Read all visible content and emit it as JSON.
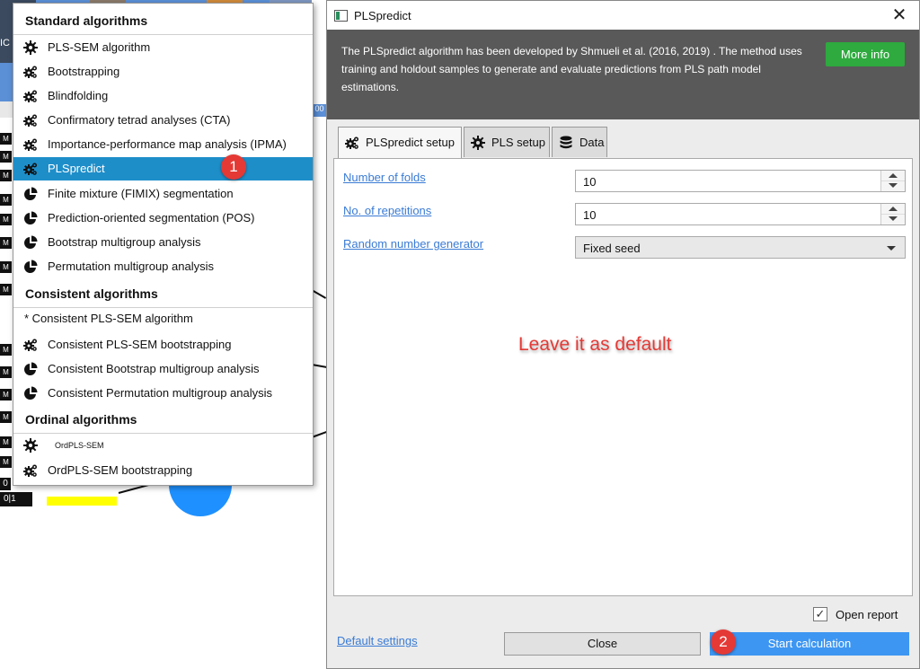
{
  "background": {
    "mini_labels": [
      "M",
      "M",
      "M",
      "M",
      "M",
      "M",
      "M",
      "M",
      "M",
      "M",
      "M",
      "M",
      "M",
      "M"
    ],
    "edge_label_1": "IC",
    "edge_label_2": "00",
    "zero": "0",
    "zero_one": "0|1"
  },
  "menu": {
    "sections": {
      "standard": "Standard algorithms",
      "consistent": "Consistent algorithms",
      "ordinal": "Ordinal algorithms"
    },
    "items": [
      {
        "label": "PLS-SEM algorithm",
        "icon": "gear-icon"
      },
      {
        "label": "Bootstrapping",
        "icon": "gears-icon"
      },
      {
        "label": "Blindfolding",
        "icon": "gears-icon"
      },
      {
        "label": "Confirmatory tetrad analyses (CTA)",
        "icon": "gears-icon"
      },
      {
        "label": "Importance-performance map analysis (IPMA)",
        "icon": "gears-icon"
      },
      {
        "label": "PLSpredict",
        "icon": "gears-icon"
      },
      {
        "label": "Finite mixture (FIMIX) segmentation",
        "icon": "pie-chart-icon"
      },
      {
        "label": "Prediction-oriented segmentation (POS)",
        "icon": "pie-chart-icon"
      },
      {
        "label": "Bootstrap multigroup analysis",
        "icon": "pie-chart-icon"
      },
      {
        "label": "Permutation multigroup analysis",
        "icon": "pie-chart-icon"
      },
      {
        "label": "* Consistent PLS-SEM algorithm",
        "icon": ""
      },
      {
        "label": "Consistent PLS-SEM bootstrapping",
        "icon": "gears-icon"
      },
      {
        "label": "Consistent Bootstrap multigroup analysis",
        "icon": "pie-chart-icon"
      },
      {
        "label": "Consistent Permutation multigroup analysis",
        "icon": "pie-chart-icon"
      },
      {
        "label": "OrdPLS-SEM",
        "icon": "gear-icon"
      },
      {
        "label": "OrdPLS-SEM bootstrapping",
        "icon": "gears-icon"
      }
    ],
    "selected_index": 5
  },
  "badges": {
    "one": "1",
    "two": "2"
  },
  "dialog": {
    "title": "PLSpredict",
    "close_glyph": "✕",
    "description": "The PLSpredict algorithm has been developed by Shmueli et al. (2016, 2019) . The method uses training and holdout samples to generate and evaluate predictions from PLS path model estimations.",
    "more_info": "More info",
    "tabs": [
      {
        "label": "PLSpredict setup",
        "icon": "gears-icon"
      },
      {
        "label": "PLS setup",
        "icon": "gear-icon"
      },
      {
        "label": "Data",
        "icon": "database-icon"
      }
    ],
    "active_tab": 0,
    "fields": {
      "folds_label": "Number of folds",
      "folds_value": "10",
      "repetitions_label": "No. of repetitions",
      "repetitions_value": "10",
      "rng_label": "Random number generator",
      "rng_value": "Fixed seed"
    },
    "annotation": "Leave it as default",
    "open_report_label": "Open report",
    "open_report_checked": "✓",
    "default_settings": "Default settings",
    "close_button": "Close",
    "start_button": "Start calculation"
  },
  "colors": {
    "selection": "#1e8ec9",
    "more_info": "#2eaa3e",
    "start": "#3d96f2",
    "badge": "#e53935",
    "info_bg": "#595959"
  }
}
